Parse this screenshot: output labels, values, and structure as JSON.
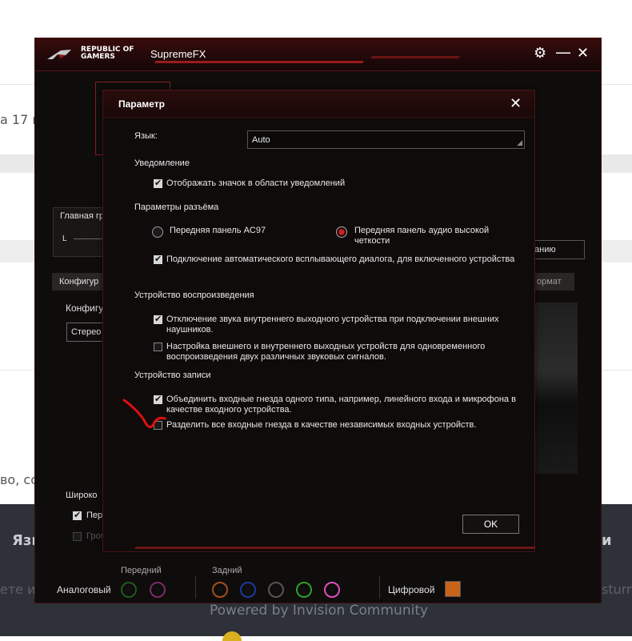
{
  "background": {
    "text_date": "а 17 и",
    "text_mid": "во, со",
    "footer_left": "Язы",
    "footer_right": "и",
    "footer_faint_left": "ете ис",
    "footer_faint_right": "sturn",
    "powered": "Powered by Invision Community"
  },
  "app": {
    "logo_line1": "REPUBLIC OF",
    "logo_line2": "GAMERS",
    "title": "SupremeFX"
  },
  "under": {
    "main_group": "Главная гр",
    "slider_l": "L",
    "config_tab": "Конфигур",
    "config_label": "Конфигу",
    "stereo": "Стерео",
    "format_tab": "ормат",
    "right_dropdown": "анию",
    "wide": "Широко",
    "per": "Пер",
    "grom": "Гром"
  },
  "dialog": {
    "title": "Параметр",
    "language_label": "Язык:",
    "language_value": "Auto",
    "notification_section": "Уведомление",
    "show_icon": "Отображать значок в области уведомлений",
    "connector_section": "Параметры разъёма",
    "front_ac97": "Передняя панель AC97",
    "front_hd": "Передняя панель аудио высокой четкости",
    "auto_popup": "Подключение автоматического всплывающего диалога, для включенного устройства",
    "playback_section": "Устройство воспроизведения",
    "mute_internal": "Отключение звука внутреннего выходного устройства при подключении внешних наушников.",
    "separate_outputs": "Настройка внешнего и внутреннего выходных устройств для одновременного воспроизведения двух различных звуковых сигналов.",
    "record_section": "Устройство записи",
    "combine_inputs": "Объединить входные гнезда одного типа, например, линейного входа и микрофона в качестве входного устройства.",
    "split_inputs": "Разделить все входные гнезда в качестве независимых входных устройств.",
    "ok": "OK"
  },
  "jackbar": {
    "front": "Передний",
    "rear": "Задний",
    "analog": "Аналоговый",
    "digital": "Цифровой"
  },
  "colors": {
    "accent": "#9b1b1b",
    "annotation": "#e01010"
  }
}
